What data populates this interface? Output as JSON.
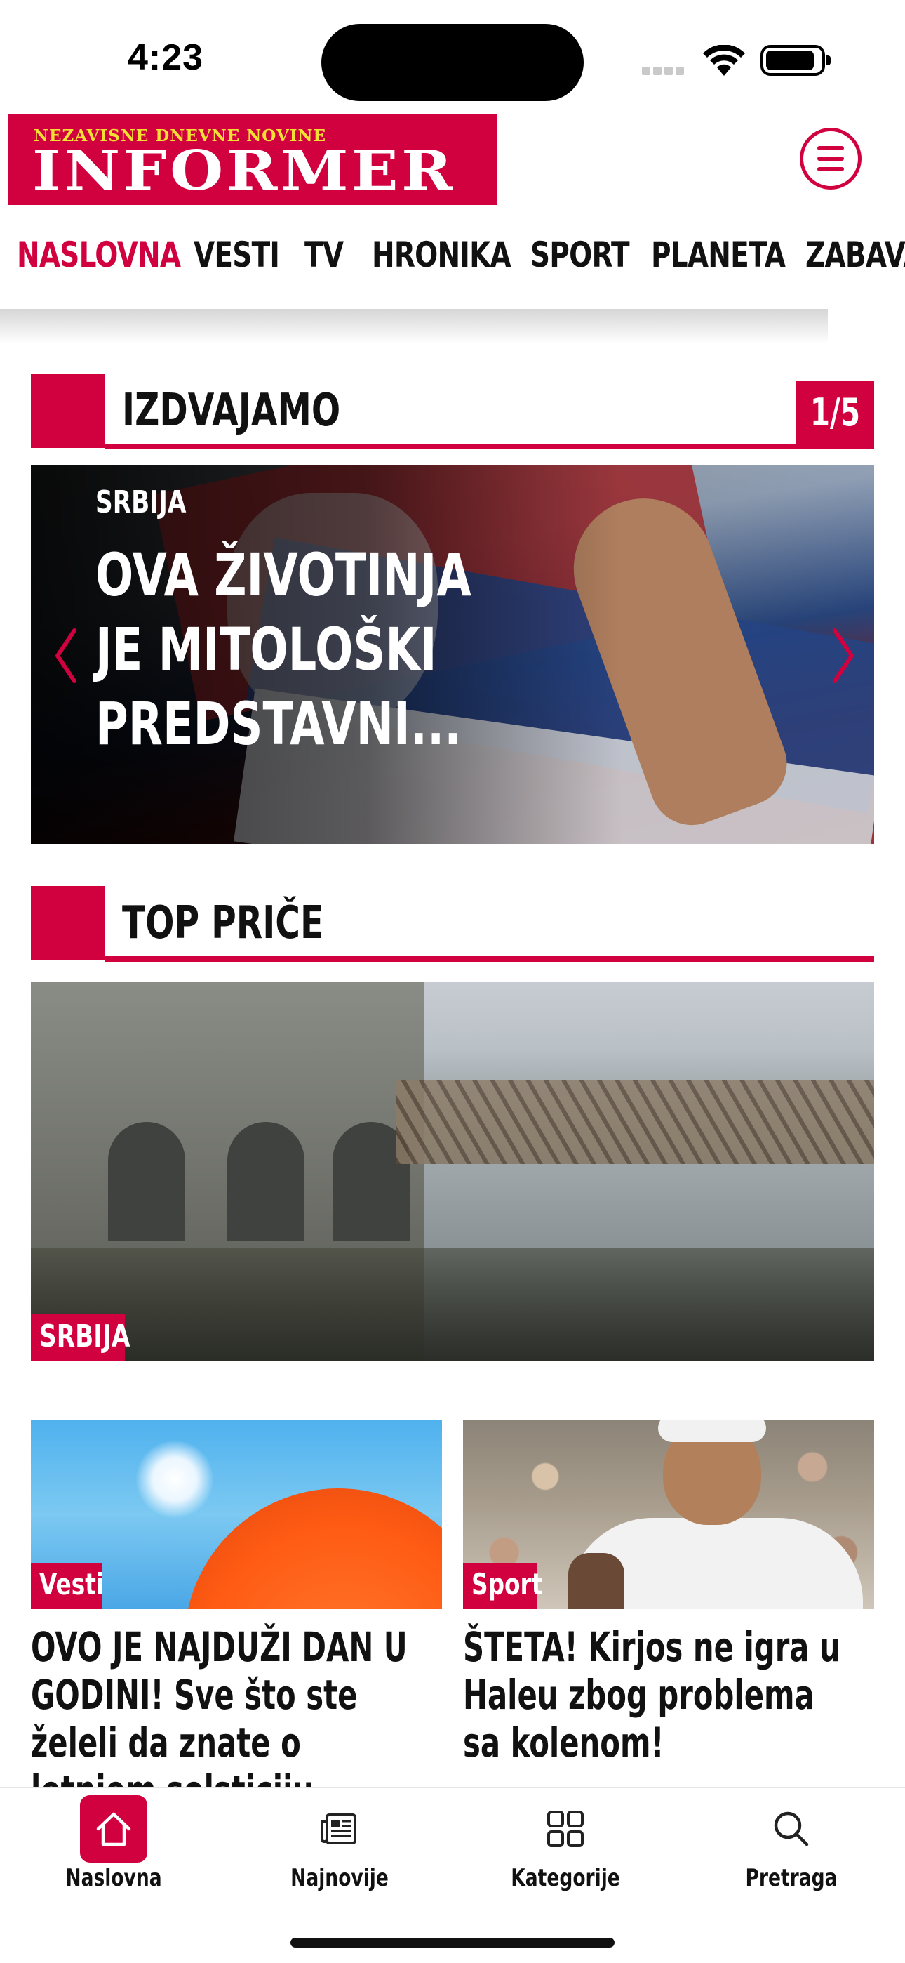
{
  "status_bar": {
    "time": "4:23"
  },
  "header": {
    "logo_tagline": "NEZAVISNE DNEVNE NOVINE",
    "logo_name": "INFORMER"
  },
  "nav": {
    "items": [
      "NASLOVNA",
      "VESTI",
      "TV",
      "HRONIKA",
      "SPORT",
      "PLANETA",
      "ZABAVA"
    ],
    "active_index": 0
  },
  "featured": {
    "title": "IZDVAJAMO",
    "pager": "1/5",
    "slide": {
      "category": "SRBIJA",
      "headline": "OVA ŽIVOTINJA JE MITOLOŠKI PREDSTAVNI..."
    }
  },
  "top_stories": {
    "title": "TOP PRIČE",
    "hero": {
      "category": "SRBIJA"
    },
    "cards": [
      {
        "category": "Vesti",
        "headline": "OVO JE NAJDUŽI DAN U GODINI! Sve što ste želeli da znate o letnjem solsticiju"
      },
      {
        "category": "Sport",
        "headline": "ŠTETA! Kirjos ne igra u Haleu zbog problema sa kolenom!"
      }
    ]
  },
  "tabbar": {
    "tabs": [
      {
        "label": "Naslovna",
        "icon": "home-icon",
        "active": true
      },
      {
        "label": "Najnovije",
        "icon": "newspaper-icon",
        "active": false
      },
      {
        "label": "Kategorije",
        "icon": "grid-icon",
        "active": false
      },
      {
        "label": "Pretraga",
        "icon": "search-icon",
        "active": false
      }
    ]
  },
  "colors": {
    "brand_red": "#d1003f",
    "logo_yellow": "#f2e033"
  }
}
